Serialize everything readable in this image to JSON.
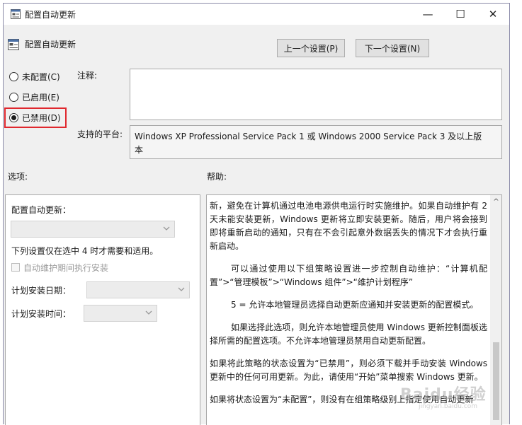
{
  "window": {
    "title": "配置自动更新"
  },
  "window_controls": {
    "minimize": "—",
    "maximize": "☐",
    "close": "✕"
  },
  "header": {
    "policy_title": "配置自动更新",
    "prev_button": "上一个设置(P)",
    "next_button": "下一个设置(N)"
  },
  "state_options": [
    {
      "label": "未配置(C)",
      "checked": false
    },
    {
      "label": "已启用(E)",
      "checked": false
    },
    {
      "label": "已禁用(D)",
      "checked": true
    }
  ],
  "comment": {
    "label": "注释:",
    "value": ""
  },
  "supported_platform": {
    "label": "支持的平台:",
    "line1": "Windows XP Professional Service Pack 1 或 Windows 2000 Service Pack 3 及以上版",
    "line2": "本"
  },
  "options": {
    "label": "选项:",
    "configure_label": "配置自动更新：",
    "configure_value": "",
    "note": "下列设置仅在选中 4 时才需要和适用。",
    "maintenance_checkbox": "自动维护期间执行安装",
    "schedule_day_label": "计划安装日期：",
    "schedule_day_value": "",
    "schedule_time_label": "计划安装时间：",
    "schedule_time_value": ""
  },
  "help": {
    "label": "帮助:",
    "paragraphs": [
      "新，避免在计算机通过电池电源供电运行时实施维护。如果自动维护有 2 天未能安装更新，Windows 更新将立即安装更新。随后，用户将会接到即将重新启动的通知，只有在不会引起意外数据丢失的情况下才会执行重新启动。",
      "可以通过使用以下组策略设置进一步控制自动维护：“计算机配置”>“管理模板”>“Windows 组件”>“维护计划程序”",
      "5 = 允许本地管理员选择自动更新应通知并安装更新的配置模式。",
      "如果选择此选项，则允许本地管理员使用 Windows 更新控制面板选择所需的配置选项。不允许本地管理员禁用自动更新配置。",
      "如果将此策略的状态设置为“已禁用”，则必须下载并手动安装 Windows 更新中的任何可用更新。为此，请使用“开始”菜单搜索 Windows 更新。",
      "如果将状态设置为“未配置”，则没有在组策略级别上指定使用自动更新"
    ]
  },
  "watermark": {
    "text": "Baidu经验",
    "sub": "jingyan.baidu.com"
  },
  "colors": {
    "highlight": "#e0282e",
    "window_bg": "#f0f0f0"
  }
}
